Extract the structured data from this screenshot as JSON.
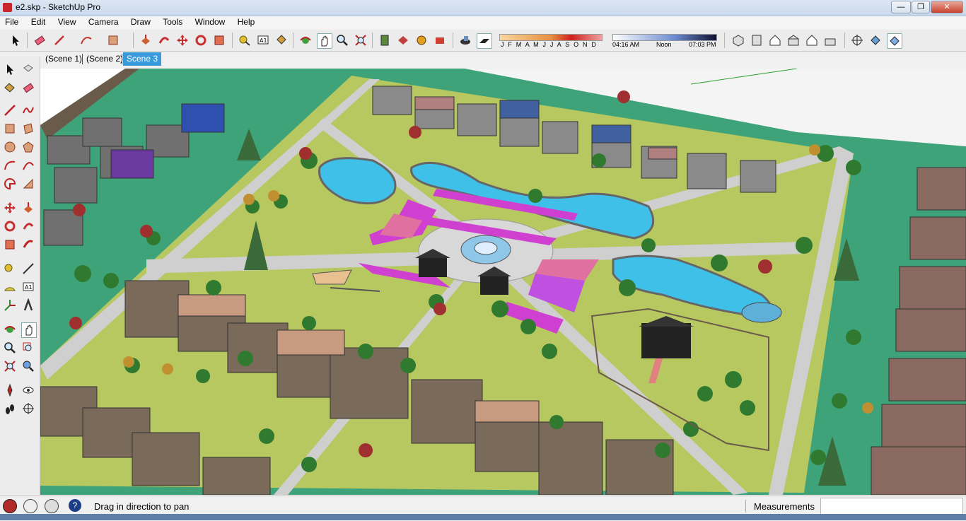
{
  "window": {
    "title": "e2.skp - SketchUp Pro",
    "minimize": "—",
    "restore": "❐",
    "close": "✕"
  },
  "menu": [
    "File",
    "Edit",
    "View",
    "Camera",
    "Draw",
    "Tools",
    "Window",
    "Help"
  ],
  "shadows": {
    "months": "J F M A M J J A S O N D",
    "time_start": "04:16 AM",
    "time_mid": "Noon",
    "time_end": "07:03 PM"
  },
  "scenes": [
    "(Scene 1)",
    "(Scene 2)",
    "Scene 3"
  ],
  "active_scene_index": 2,
  "status": {
    "hint": "Drag in direction to pan",
    "measurements_label": "Measurements",
    "measurements_value": ""
  },
  "colors": {
    "accent": "#3a9bdc",
    "grass": "#3fa37a",
    "park_grass": "#b7c860",
    "water": "#3fc0e8",
    "path": "#cfcfcf"
  }
}
